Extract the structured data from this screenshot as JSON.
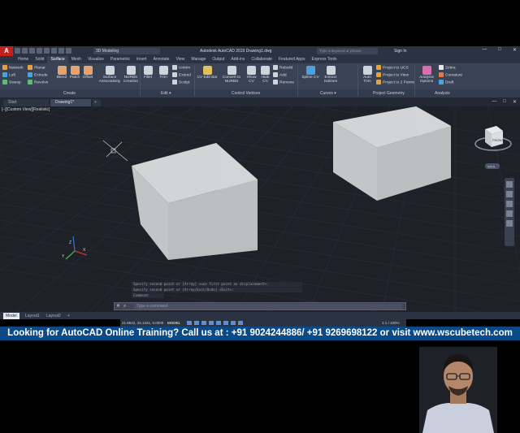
{
  "app": {
    "logo": "A",
    "workspace": "3D Modeling",
    "title": "Autodesk AutoCAD 2019   Drawing1.dwg",
    "search_placeholder": "Type a keyword or phrase",
    "signin": "Sign In",
    "window_controls": [
      "—",
      "□",
      "✕"
    ]
  },
  "ribbon_tabs": [
    "Home",
    "Solid",
    "Surface",
    "Mesh",
    "Visualize",
    "Parametric",
    "Insert",
    "Annotate",
    "View",
    "Manage",
    "Output",
    "Add-ins",
    "Collaborate",
    "Featured Apps",
    "Express Tools"
  ],
  "active_tab": "Surface",
  "ribbon": {
    "create_small": [
      "Network",
      "Loft",
      "Sweep"
    ],
    "create_small2": [
      "Planar",
      "Extrude",
      "Revolve"
    ],
    "create_large": [
      "Blend",
      "Patch",
      "Offset",
      "Surface Associativity",
      "NURBS Creation"
    ],
    "edit_large": [
      "Fillet",
      "Trim"
    ],
    "edit_small": [
      "Untrim",
      "Extend",
      "Sculpt"
    ],
    "control_vertices_large": [
      "CV Edit Bar",
      "Convert to NURBS",
      "Show CV",
      "Hide CV"
    ],
    "control_vertices_small": [
      "Rebuild",
      "Add",
      "Remove"
    ],
    "curves_large": [
      "Spline CV",
      "Extract Isolines"
    ],
    "project_large": [
      "Auto Trim"
    ],
    "project_small": [
      "Project to UCS",
      "Project to View",
      "Project to 2 Points"
    ],
    "analysis_large": [
      "Analysis Options"
    ],
    "analysis_small": [
      "Zebra",
      "Curvature",
      "Draft"
    ],
    "panel_labels": [
      "Create",
      "Edit ▾",
      "Control Vertices",
      "Curves ▾",
      "Project Geometry",
      "Analysis"
    ]
  },
  "file_tabs": [
    "Start",
    "Drawing1*"
  ],
  "viewport_label": "[–][Custom View][Realistic]",
  "viewcube": {
    "face": "FRONT",
    "ucs": "WCS"
  },
  "command": {
    "history": [
      "Specify second point or [Array] <use first point as displacement>:",
      "Specify second point or [Array/Exit/Undo] <Exit>:"
    ],
    "prompt_line": "Command:",
    "placeholder": "Type a command"
  },
  "layout_tabs": [
    "Model",
    "Layout1",
    "Layout2"
  ],
  "status": {
    "coords": "21.8642, 34.1331, 0.0000",
    "model": "MODEL",
    "zoom": "1:1 / 100%"
  },
  "banner": "Looking for AutoCAD Online Training? Call us at : +91 9024244886/ +91 9269698122 or visit www.wscubetech.com",
  "colors": {
    "ribbon_bg": "#3a4356",
    "viewport_bg": "#1e2228",
    "banner_bg": "#0b4a86",
    "box_face": "#bfc0c2"
  }
}
